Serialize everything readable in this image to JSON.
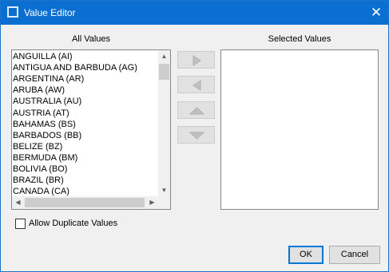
{
  "window": {
    "title": "Value Editor",
    "close_glyph": "✕"
  },
  "all_values": {
    "label": "All Values",
    "items": [
      "ANGUILLA (AI)",
      "ANTIGUA AND BARBUDA (AG)",
      "ARGENTINA (AR)",
      "ARUBA (AW)",
      "AUSTRALIA (AU)",
      "AUSTRIA (AT)",
      "BAHAMAS (BS)",
      "BARBADOS (BB)",
      "BELIZE (BZ)",
      "BERMUDA (BM)",
      "BOLIVIA (BO)",
      "BRAZIL (BR)",
      "CANADA (CA)"
    ]
  },
  "selected_values": {
    "label": "Selected Values",
    "items": []
  },
  "move_buttons": [
    {
      "name": "add-button",
      "icon": "triangle-right-icon"
    },
    {
      "name": "remove-button",
      "icon": "triangle-left-icon"
    },
    {
      "name": "move-up-button",
      "icon": "triangle-up-icon"
    },
    {
      "name": "move-down-button",
      "icon": "triangle-down-icon"
    }
  ],
  "options": {
    "allow_duplicates_label": "Allow Duplicate Values",
    "allow_duplicates_checked": false
  },
  "buttons": {
    "ok": "OK",
    "cancel": "Cancel"
  },
  "colors": {
    "titlebar": "#0a6fd1",
    "focus_border": "#0078d7",
    "icon_fill": "#c0c0c0"
  }
}
